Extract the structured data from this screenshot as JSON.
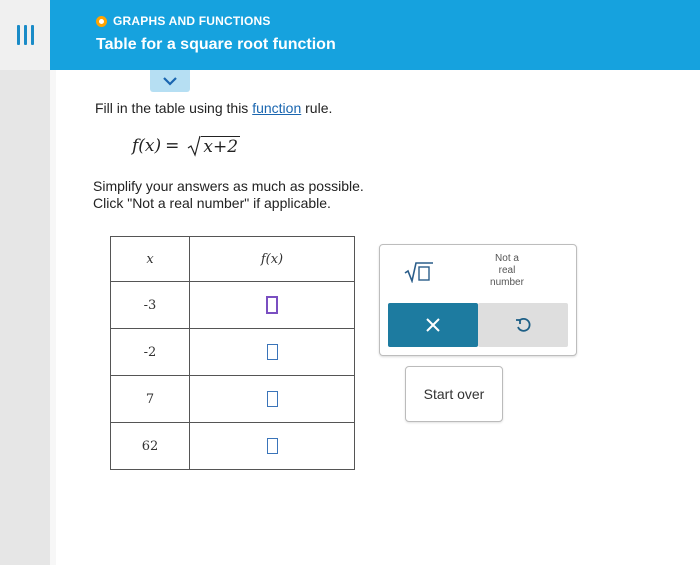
{
  "header": {
    "topic": "GRAPHS AND FUNCTIONS",
    "title": "Table for a square root function"
  },
  "instructions": {
    "line1_prefix": "Fill in the table using this ",
    "line1_link": "function",
    "line1_suffix": " rule.",
    "formula_lhs": "f(x)",
    "formula_eq": "=",
    "formula_radicand": "x+2",
    "simplify_line1": "Simplify your answers as much as possible.",
    "simplify_line2": "Click \"Not a real number\" if applicable."
  },
  "table": {
    "header_x": "x",
    "header_f": "f(x)",
    "rows": [
      {
        "x": "-3",
        "fx": ""
      },
      {
        "x": "-2",
        "fx": ""
      },
      {
        "x": "7",
        "fx": ""
      },
      {
        "x": "62",
        "fx": ""
      }
    ]
  },
  "keypad": {
    "sqrt_key": "square-root-template",
    "not_real_line1": "Not a",
    "not_real_line2": "real",
    "not_real_line3": "number",
    "clear_icon": "x-icon",
    "undo_icon": "undo-icon"
  },
  "start_over": "Start over",
  "colors": {
    "header_bg": "#16a2de",
    "topic_dot": "#ffa300",
    "link": "#1a66b0",
    "clear_key": "#1d7ba0",
    "active_input_border": "#7a4fc1"
  }
}
